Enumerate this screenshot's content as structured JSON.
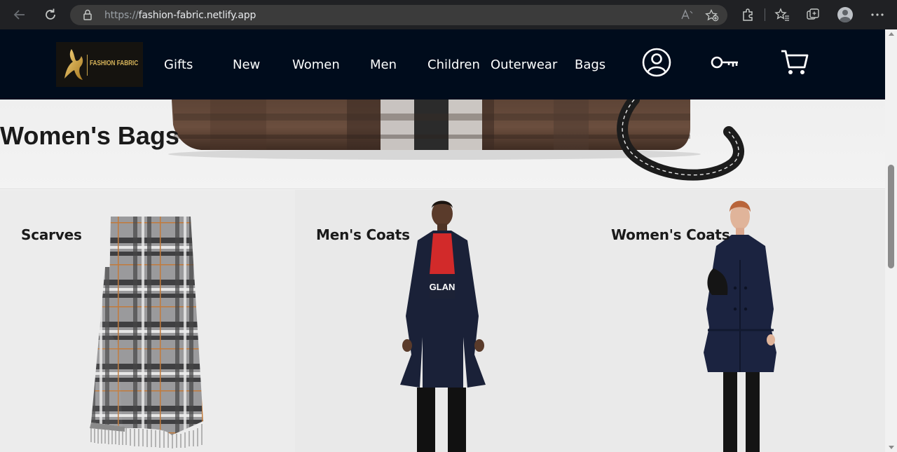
{
  "browser": {
    "url_protocol": "https://",
    "url_host": "fashion-fabric.netlify.app",
    "icons": [
      "back-icon",
      "refresh-icon",
      "lock-icon",
      "read-aloud-icon",
      "add-favorite-icon",
      "extensions-icon",
      "favorites-icon",
      "collections-icon",
      "profile-icon",
      "more-icon"
    ]
  },
  "header": {
    "logo_text": "FASHION FABRIC",
    "nav": [
      "Gifts",
      "New",
      "Women",
      "Men",
      "Children",
      "Outerwear",
      "Bags"
    ],
    "icons": [
      "account-icon",
      "key-icon",
      "cart-icon"
    ]
  },
  "banner": {
    "title": "Women's Bags"
  },
  "categories": [
    {
      "title": "Scarves"
    },
    {
      "title": "Men's Coats"
    },
    {
      "title": "Women's Coats"
    }
  ],
  "colors": {
    "header_bg": "#000c1c",
    "logo_gold": "#d7b45a",
    "card_bg": "#ebebeb"
  }
}
